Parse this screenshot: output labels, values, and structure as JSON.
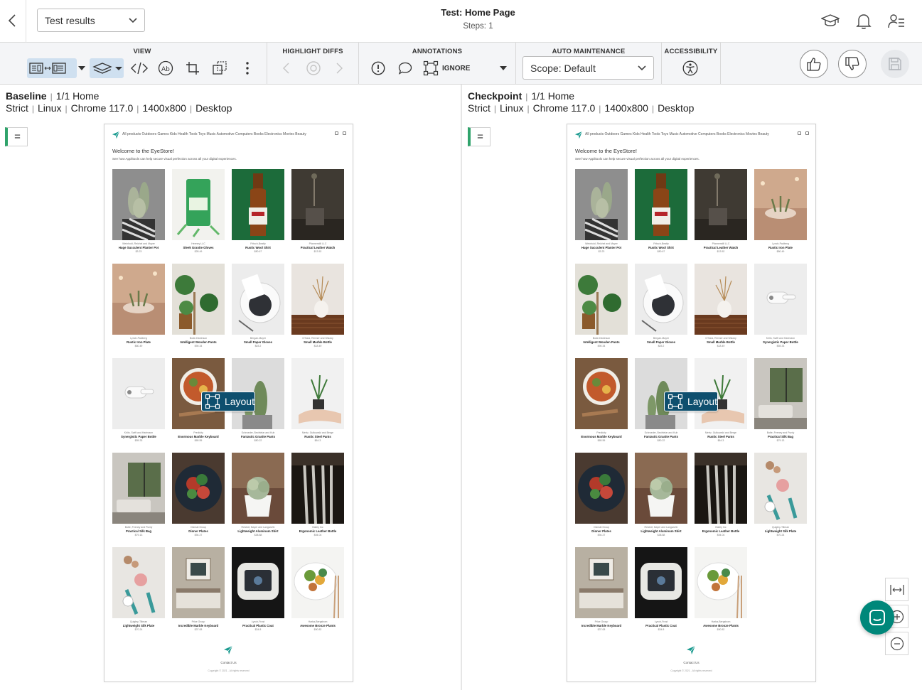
{
  "header": {
    "view_select": "Test results",
    "test_title": "Test:  Home Page",
    "steps": "Steps: 1"
  },
  "toolbar": {
    "groups": {
      "view": "VIEW",
      "highlight_diffs": "HIGHLIGHT DIFFS",
      "annotations": "ANNOTATIONS",
      "auto_maintenance": "AUTO MAINTENANCE",
      "accessibility": "ACCESSIBILITY"
    },
    "ignore_label": "IGNORE",
    "scope_select": "Scope: Default"
  },
  "baseline": {
    "label": "Baseline",
    "step": "1/1 Home",
    "match_level": "Strict",
    "os": "Linux",
    "browser": "Chrome 117.0",
    "viewport": "1400x800",
    "device": "Desktop",
    "diff_symbol": "="
  },
  "checkpoint": {
    "label": "Checkpoint",
    "step": "1/1 Home",
    "match_level": "Strict",
    "os": "Linux",
    "browser": "Chrome 117.0",
    "viewport": "1400x800",
    "device": "Desktop",
    "diff_symbol": "="
  },
  "region_tag": "Layout",
  "store": {
    "nav": "All products   Outdoors   Games   Kids   Health   Tools   Toys   Music   Automotive   Computers   Books   Electronics   Movies   Beauty",
    "welcome": "Welcome to the EyeStore!",
    "subtitle": "See how Applitools can help secure visual perfection across all your digital experiences.",
    "contact": "Contact Us",
    "copyright": "Copyright © 2021 - All rights reserved"
  },
  "baseline_products": [
    {
      "vendor": "Weinhold, Reichel and Mayer",
      "name": "Huge Succulent Planter Pot",
      "price": "$3.23",
      "img": "cactus-pot"
    },
    {
      "vendor": "Heeney LLC",
      "name": "Sleek Granite Gloves",
      "price": "$28.49",
      "img": "tea-bag"
    },
    {
      "vendor": "Fritsch-Beatty",
      "name": "Rustic Wool Shirt",
      "price": "$80.67",
      "img": "beer-bottle"
    },
    {
      "vendor": "Pfannerstill LLC",
      "name": "Practical Leather Watch",
      "price": "$13.52",
      "img": "dark-room"
    },
    {
      "vendor": "Lynch-Padberg",
      "name": "Rustic Iron Plate",
      "price": "$80.49",
      "img": "table-setting"
    },
    {
      "vendor": "Bode-Dickinson",
      "name": "Intelligent Wooden Pants",
      "price": "$90.34",
      "img": "plants-shelf"
    },
    {
      "vendor": "Bergan-Mayer",
      "name": "Small Paper Gloves",
      "price": "$45.2",
      "img": "plate-menu"
    },
    {
      "vendor": "O'Hara, Renner and Wisoky",
      "name": "Small Marble Bottle",
      "price": "$18.49",
      "img": "vase"
    },
    {
      "vendor": "Kirlin, Swift and Hartmann",
      "name": "Synergistic Paper Bottle",
      "price": "$55.33",
      "img": "earbuds"
    },
    {
      "vendor": "Predicity",
      "name": "Enormous Marble Keyboard",
      "price": "$65.55",
      "img": "food-bowl"
    },
    {
      "vendor": "Schroeder, Bechtelar and Kub",
      "name": "Fantastic Granite Pants",
      "price": "$80.22",
      "img": "cactus-spoon"
    },
    {
      "vendor": "Mertz, Gutkowski and Berge",
      "name": "Rustic Steel Pants",
      "price": "$64.3",
      "img": "hand-plant"
    },
    {
      "vendor": "Botle, Feeney and Purdy",
      "name": "Practical Silk Bag",
      "price": "$79.13",
      "img": "living-room"
    },
    {
      "vendor": "Osinski Group",
      "name": "Dinner Plates",
      "price": "$94.27",
      "img": "dinner-plate"
    },
    {
      "vendor": "Reichel, Bayer and Langworth",
      "name": "Lightweight Aluminum Shirt",
      "price": "$38.88",
      "img": "succulent-cup"
    },
    {
      "vendor": "Bailey Inc",
      "name": "Ergonomic Leather Bottle",
      "price": "$94.04",
      "img": "forks"
    },
    {
      "vendor": "Quigley-Tillman",
      "name": "Lightweight Silk Plate",
      "price": "$70.24",
      "img": "kitchen-table"
    },
    {
      "vendor": "Price Group",
      "name": "Incredible Marble Keyboard",
      "price": "$37.08",
      "img": "bedroom"
    },
    {
      "vendor": "Lynch-Frost",
      "name": "Practical Plastic Coat",
      "price": "$34.8",
      "img": "phone-dish"
    },
    {
      "vendor": "Harba-Bergstrom",
      "name": "Awesome Bronze Plants",
      "price": "$90.82",
      "img": "salad-bowl"
    }
  ],
  "checkpoint_products": [
    {
      "vendor": "Weinhold, Reichel and Mayer",
      "name": "Huge Succulent Planter Pot",
      "price": "$3.23",
      "img": "cactus-pot"
    },
    {
      "vendor": "Fritsch-Beatty",
      "name": "Rustic Wool Shirt",
      "price": "$80.67",
      "img": "beer-bottle"
    },
    {
      "vendor": "Pfannerstill LLC",
      "name": "Practical Leather Watch",
      "price": "$13.52",
      "img": "dark-room"
    },
    {
      "vendor": "Lynch-Padberg",
      "name": "Rustic Iron Plate",
      "price": "$80.49",
      "img": "table-setting"
    },
    {
      "vendor": "Bode-Dickinson",
      "name": "Intelligent Wooden Pants",
      "price": "$90.34",
      "img": "plants-shelf"
    },
    {
      "vendor": "Bergan-Mayer",
      "name": "Small Paper Gloves",
      "price": "$45.2",
      "img": "plate-menu"
    },
    {
      "vendor": "O'Hara, Renner and Wisoky",
      "name": "Small Marble Bottle",
      "price": "$18.49",
      "img": "vase"
    },
    {
      "vendor": "Kirlin, Swift and Hartmann",
      "name": "Synergistic Paper Bottle",
      "price": "$55.33",
      "img": "earbuds"
    },
    {
      "vendor": "Predicity",
      "name": "Enormous Marble Keyboard",
      "price": "$65.55",
      "img": "food-bowl"
    },
    {
      "vendor": "Schroeder, Bechtelar and Kub",
      "name": "Fantastic Granite Pants",
      "price": "$80.22",
      "img": "cactus-spoon"
    },
    {
      "vendor": "Mertz, Gutkowski and Berge",
      "name": "Rustic Steel Pants",
      "price": "$64.3",
      "img": "hand-plant"
    },
    {
      "vendor": "Botle, Feeney and Purdy",
      "name": "Practical Silk Bag",
      "price": "$79.13",
      "img": "living-room"
    },
    {
      "vendor": "Osinski Group",
      "name": "Dinner Plates",
      "price": "$94.27",
      "img": "dinner-plate"
    },
    {
      "vendor": "Reichel, Bayer and Langworth",
      "name": "Lightweight Aluminum Shirt",
      "price": "$38.88",
      "img": "succulent-cup"
    },
    {
      "vendor": "Bailey Inc",
      "name": "Ergonomic Leather Bottle",
      "price": "$94.04",
      "img": "forks"
    },
    {
      "vendor": "Quigley-Tillman",
      "name": "Lightweight Silk Plate",
      "price": "$70.24",
      "img": "kitchen-table"
    },
    {
      "vendor": "Price Group",
      "name": "Incredible Marble Keyboard",
      "price": "$37.08",
      "img": "bedroom"
    },
    {
      "vendor": "Lynch-Frost",
      "name": "Practical Plastic Coat",
      "price": "$34.8",
      "img": "phone-dish"
    },
    {
      "vendor": "Harba-Bergstrom",
      "name": "Awesome Bronze Plants",
      "price": "$90.82",
      "img": "salad-bowl"
    }
  ],
  "colors": {
    "accent_green": "#2fa36b",
    "layout_tag": "#0e4f6e",
    "chat": "#00877a",
    "logo_teal": "#1a9a8f"
  },
  "icons": {
    "back": "chevron-left-icon",
    "graduation": "graduation-cap-icon",
    "bell": "bell-icon",
    "user_list": "user-list-icon",
    "thumbs_up": "thumbs-up-icon",
    "thumbs_down": "thumbs-down-icon",
    "save": "save-icon"
  }
}
